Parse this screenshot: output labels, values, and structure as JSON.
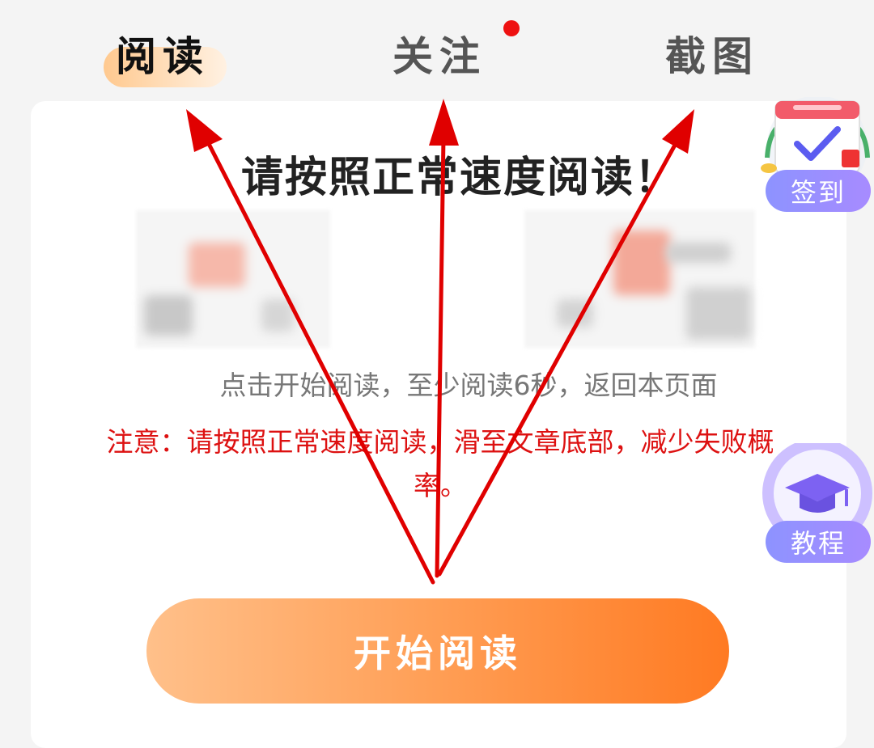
{
  "tabs": [
    {
      "label": "阅读",
      "active": true
    },
    {
      "label": "关注",
      "active": false,
      "has_notification_dot": true
    },
    {
      "label": "截图",
      "active": false
    }
  ],
  "card": {
    "title": "请按照正常速度阅读！",
    "hint": "点击开始阅读，至少阅读6秒，返回本页面",
    "notice": "注意：请按照正常速度阅读，滑至文章底部，减少失败概率。",
    "start_button": "开始阅读"
  },
  "floating": {
    "signin_label": "签到",
    "tutorial_label": "教程"
  },
  "colors": {
    "notice_red": "#dd1111",
    "arrow_red": "#e00000",
    "button_start": "#ffc08a",
    "button_end": "#ff7a22",
    "pill_purple": "#9a8dff"
  },
  "icons": [
    "calendar-check-icon",
    "graduation-cap-icon"
  ]
}
